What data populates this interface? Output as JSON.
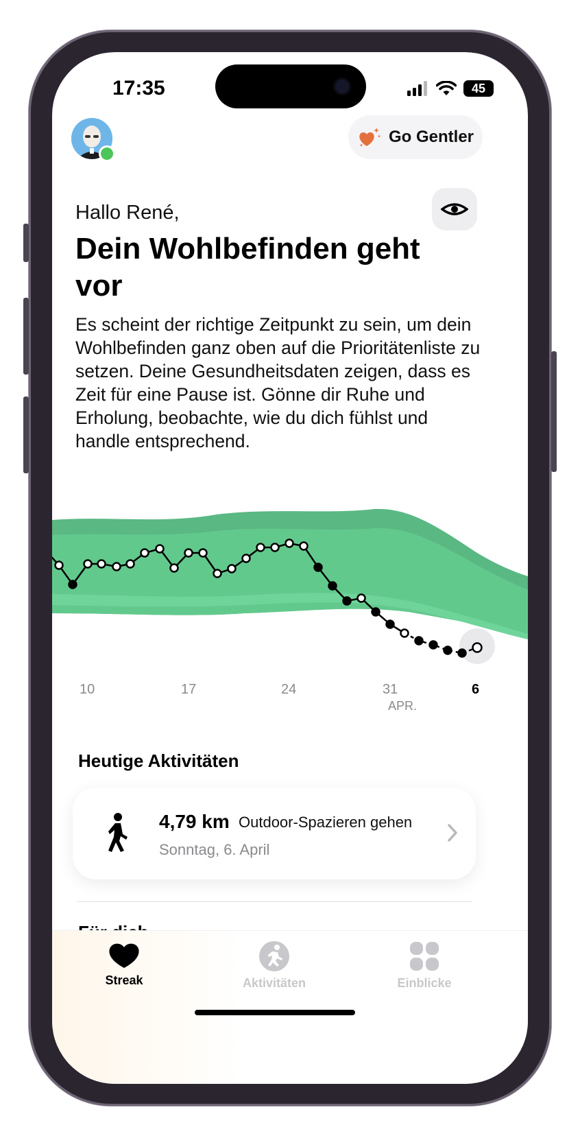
{
  "status_bar": {
    "time": "17:35",
    "battery": "45"
  },
  "header": {
    "go_gentler_label": "Go Gentler",
    "go_gentler_icon": "heart-sparkle-icon",
    "privacy_icon": "eye-icon"
  },
  "greeting": "Hallo René,",
  "headline": "Dein Wohlbefinden geht vor",
  "body": "Es scheint der richtige Zeitpunkt zu sein, um dein Wohlbefinden ganz oben auf die Prioritätenliste zu setzen. Deine Gesundheitsdaten zeigen, dass es Zeit für eine Pause ist. Gönne dir Ruhe und Erholung, beobachte, wie du dich fühlst und handle entsprechend.",
  "chart": {
    "x_labels": [
      "10",
      "17",
      "24",
      "31",
      "6"
    ],
    "month_label": "APR.",
    "colors": {
      "band_outer": "#5ab883",
      "band_inner": "#62c98d",
      "line": "#000000"
    }
  },
  "activities": {
    "title": "Heutige Aktivitäten",
    "items": [
      {
        "distance": "4,79 km",
        "type": "Outdoor-Spazieren gehen",
        "date": "Sonntag, 6. April",
        "icon": "walking-icon"
      }
    ]
  },
  "fuer_dich": {
    "title": "Für dich"
  },
  "tabbar": {
    "items": [
      {
        "label": "Streak",
        "icon": "streak-heart-icon",
        "active": true
      },
      {
        "label": "Aktivitäten",
        "icon": "runner-icon",
        "active": false
      },
      {
        "label": "Einblicke",
        "icon": "grid-icon",
        "active": false
      }
    ],
    "active_color": "#000000",
    "inactive_color": "#c8c8cc"
  }
}
